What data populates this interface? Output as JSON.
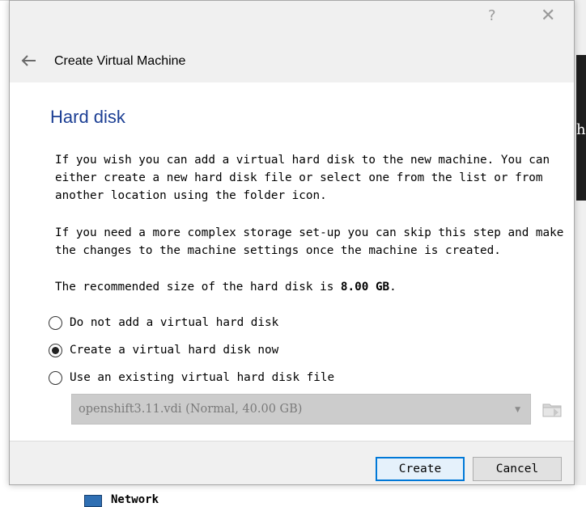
{
  "dialog": {
    "help_glyph": "?",
    "close_glyph": "✕",
    "wizard_title": "Create Virtual Machine",
    "page_title": "Hard disk",
    "paragraph1": "If you wish you can add a virtual hard disk to the new machine. You can either create a new hard disk file or select one from the list or from another location using the folder icon.",
    "paragraph2": "If you need a more complex storage set-up you can skip this step and make the changes to the machine settings once the machine is created.",
    "recommended_prefix": "The recommended size of the hard disk is ",
    "recommended_size": "8.00 GB",
    "recommended_suffix": ".",
    "options": [
      {
        "label": "Do not add a virtual hard disk",
        "selected": false
      },
      {
        "label": "Create a virtual hard disk now",
        "selected": true
      },
      {
        "label": "Use an existing virtual hard disk file",
        "selected": false
      }
    ],
    "existing_disk_selected": "openshift3.11.vdi (Normal, 40.00 GB)",
    "buttons": {
      "create": "Create",
      "cancel": "Cancel"
    }
  },
  "background": {
    "partial_char": "h",
    "network_label": "Network"
  },
  "colors": {
    "title_blue": "#1c3f94",
    "default_button_border": "#0078d7",
    "dialog_bg": "#f0f0f0"
  },
  "icons": [
    "back-arrow-icon",
    "help-icon",
    "close-icon",
    "folder-icon",
    "dropdown-arrow-icon",
    "network-icon"
  ]
}
